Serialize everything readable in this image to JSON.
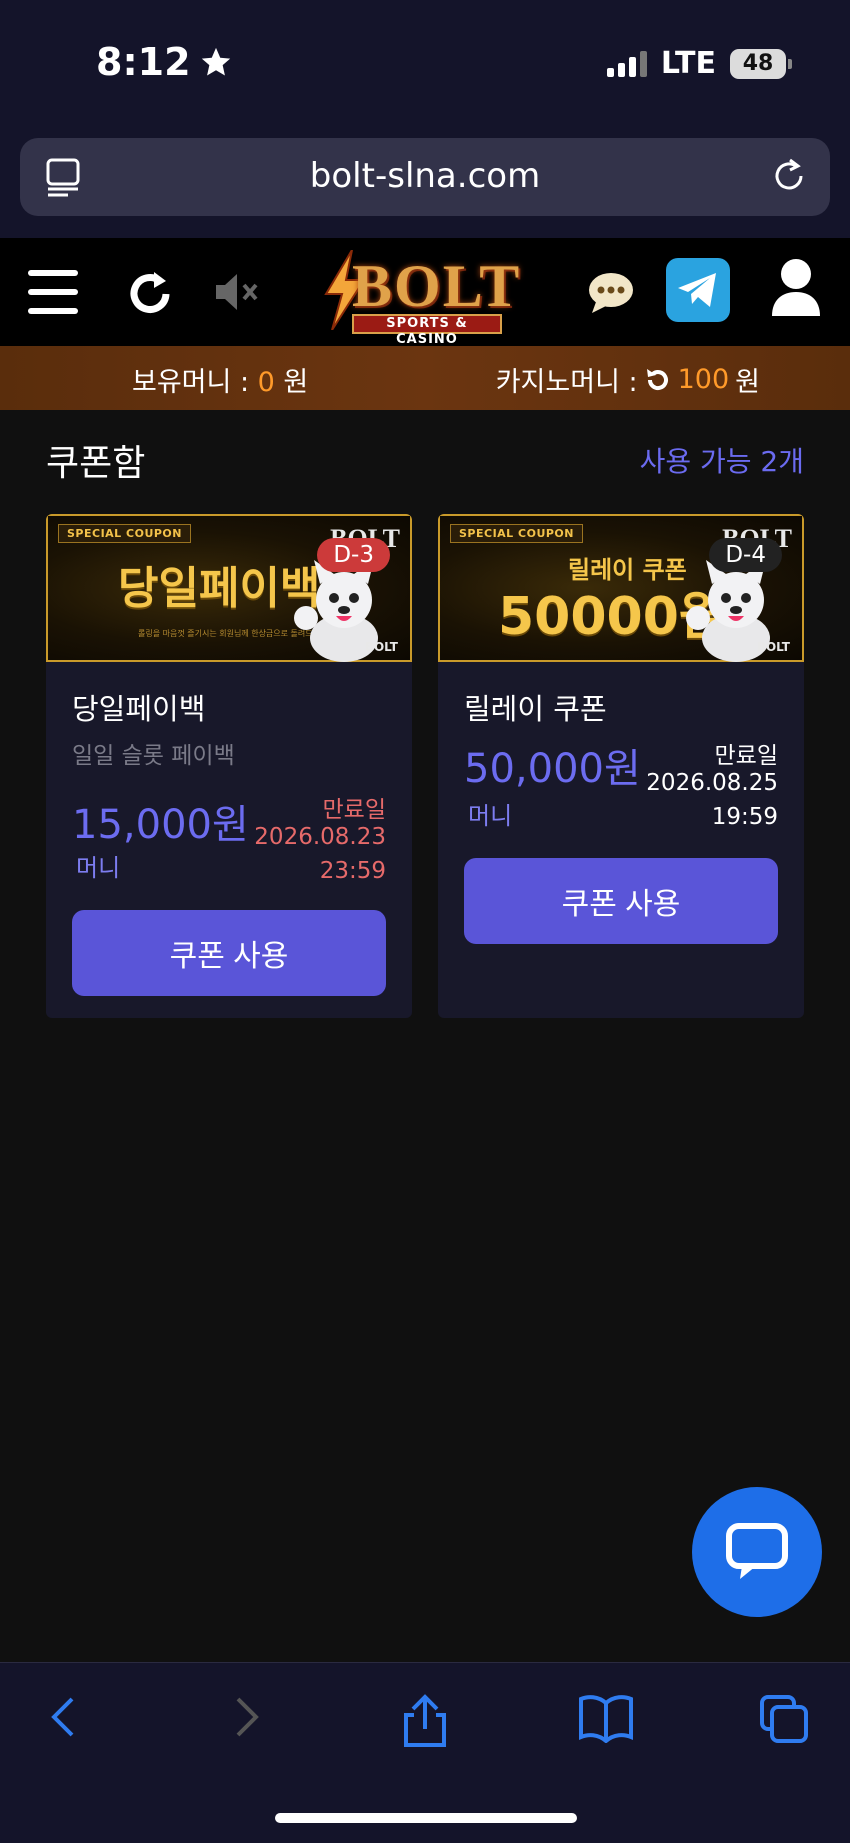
{
  "status_bar": {
    "time": "8:12",
    "network": "LTE",
    "battery": "48"
  },
  "browser": {
    "url": "bolt-slna.com"
  },
  "header": {
    "logo_text": "BOLT",
    "logo_sub": "SPORTS & CASINO",
    "icons": [
      "menu-icon",
      "refresh-icon",
      "mute-icon",
      "chat-bubble-icon",
      "telegram-icon",
      "user-icon"
    ]
  },
  "money": {
    "holding_label": "보유머니 :",
    "holding_value": "0",
    "holding_unit": "원",
    "casino_label": "카지노머니 :",
    "casino_value": "100",
    "casino_unit": "원"
  },
  "coupons": {
    "title": "쿠폰함",
    "available": "사용 가능 2개",
    "items": [
      {
        "banner_tag": "SPECIAL COUPON",
        "banner_text": "당일페이백",
        "banner_small": "롤링을 마음껏 즐기시는 회원님께 한상금으로 돌려드립니다",
        "banner_logo": "BOLT",
        "dday": "D-3",
        "name": "당일페이백",
        "subtitle": "일일 슬롯 페이백",
        "amount": "15,000원",
        "unit": "머니",
        "expiry_label": "만료일",
        "expiry_date": "2026.08.23",
        "expiry_time": "23:59",
        "button": "쿠폰 사용"
      },
      {
        "banner_tag": "SPECIAL COUPON",
        "banner_title": "릴레이 쿠폰",
        "banner_amount": "50000원",
        "banner_logo": "BOLT",
        "dday": "D-4",
        "name": "릴레이 쿠폰",
        "amount": "50,000원",
        "unit": "머니",
        "expiry_label": "만료일",
        "expiry_date": "2026.08.25",
        "expiry_time": "19:59",
        "button": "쿠폰 사용"
      }
    ]
  },
  "toolbar": {
    "icons": [
      "back-icon",
      "forward-icon",
      "share-icon",
      "bookmarks-icon",
      "tabs-icon"
    ]
  },
  "colors": {
    "accent": "#5a55d8",
    "amount": "#6c6cf0",
    "money_highlight": "#ff9a2a",
    "expiry_red": "#e66a6a"
  }
}
